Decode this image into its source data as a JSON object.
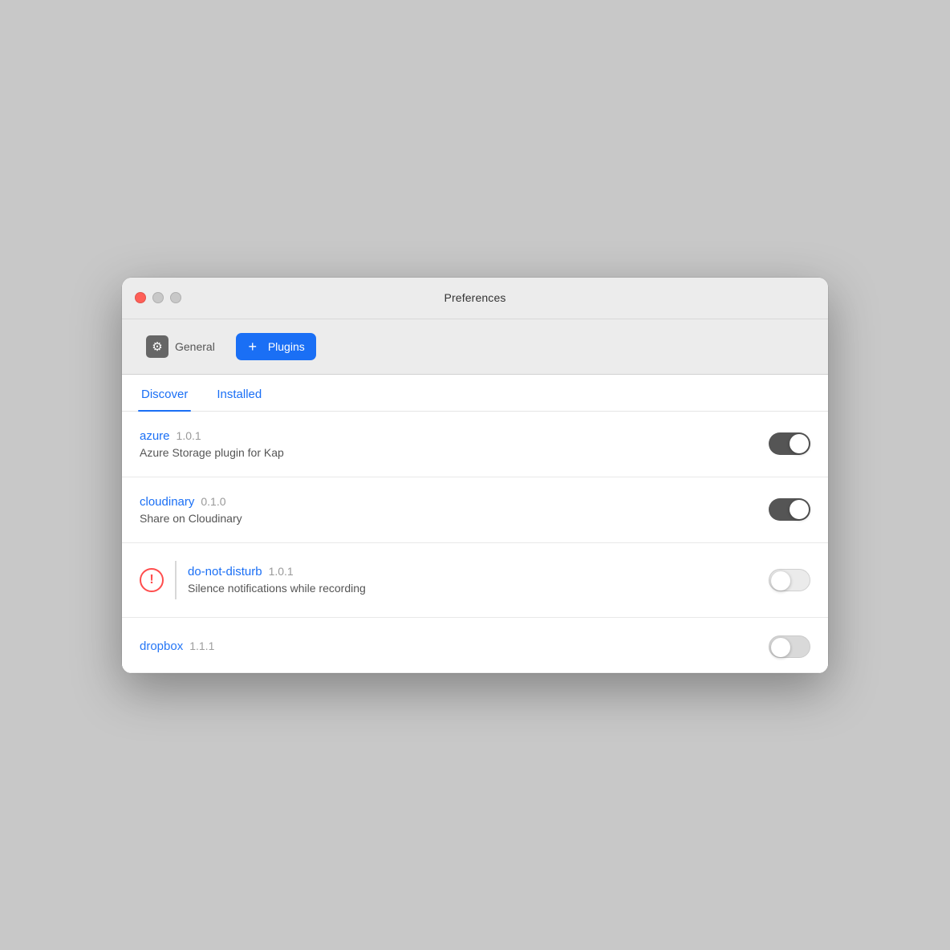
{
  "window": {
    "title": "Preferences"
  },
  "toolbar": {
    "general_label": "General",
    "plugins_label": "Plugins"
  },
  "tabs": [
    {
      "id": "discover",
      "label": "Discover",
      "active": true
    },
    {
      "id": "installed",
      "label": "Installed",
      "active": false
    }
  ],
  "plugins": [
    {
      "id": "azure",
      "name": "azure",
      "version": "1.0.1",
      "description": "Azure Storage plugin for Kap",
      "enabled": true,
      "error": false
    },
    {
      "id": "cloudinary",
      "name": "cloudinary",
      "version": "0.1.0",
      "description": "Share on Cloudinary",
      "enabled": true,
      "error": false
    },
    {
      "id": "do-not-disturb",
      "name": "do-not-disturb",
      "version": "1.0.1",
      "description": "Silence notifications while recording",
      "enabled": false,
      "error": true
    },
    {
      "id": "dropbox",
      "name": "dropbox",
      "version": "1.1.1",
      "description": "",
      "enabled": false,
      "error": false,
      "partial": true
    }
  ],
  "icons": {
    "gear": "⚙",
    "plus": "+",
    "exclamation": "!"
  },
  "colors": {
    "accent": "#1a6ff5",
    "toggle_on": "#555555",
    "toggle_off": "#d8d8d8",
    "error": "#ff4d4d",
    "close": "#ff5f57"
  }
}
